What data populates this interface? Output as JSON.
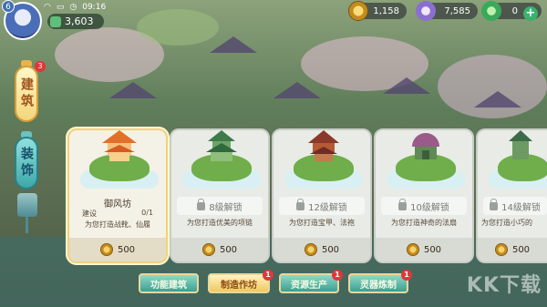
{
  "hud": {
    "level": "6",
    "time": "09:16",
    "jade": "3,603",
    "coins": "1,158",
    "gems": "7,585",
    "tokens": "0"
  },
  "side_tabs": {
    "build": {
      "label": "建筑",
      "badge": "3"
    },
    "deco": {
      "label": "装饰"
    }
  },
  "cards": [
    {
      "name": "御风坊",
      "status_label": "建设",
      "count": "0/1",
      "desc": "为您打造战靴、仙履",
      "price": "500",
      "locked": false
    },
    {
      "lock_text": "8级解锁",
      "desc": "为您打造优美的项链",
      "price": "500",
      "locked": true
    },
    {
      "lock_text": "12级解锁",
      "desc": "为您打造宝甲、法袍",
      "price": "500",
      "locked": true
    },
    {
      "lock_text": "10级解锁",
      "desc": "为您打造神奇的法扇",
      "price": "500",
      "locked": true
    },
    {
      "lock_text": "14级解锁",
      "desc": "为您打造小巧的",
      "price": "500",
      "locked": true
    }
  ],
  "bottom_tabs": [
    {
      "label": "功能建筑",
      "active": false,
      "badge": ""
    },
    {
      "label": "制造作坊",
      "active": true,
      "badge": "1"
    },
    {
      "label": "资源生产",
      "active": false,
      "badge": "1"
    },
    {
      "label": "灵器炼制",
      "active": false,
      "badge": "1"
    }
  ],
  "watermark": "KK下载",
  "colors": {
    "accent": "#f0c85e",
    "teal": "#3d9f93",
    "badge": "#e3353a"
  }
}
